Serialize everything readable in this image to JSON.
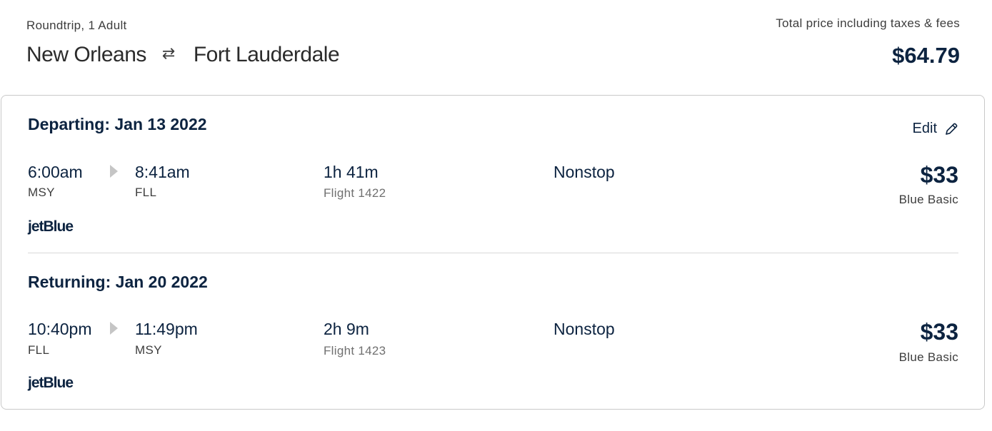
{
  "header": {
    "trip_type": "Roundtrip, 1 Adult",
    "origin": "New Orleans",
    "destination": "Fort Lauderdale",
    "total_label": "Total price including taxes & fees",
    "total_price": "$64.79"
  },
  "edit_label": "Edit",
  "departing": {
    "title": "Departing: Jan 13 2022",
    "depart_time": "6:00am",
    "depart_code": "MSY",
    "arrive_time": "8:41am",
    "arrive_code": "FLL",
    "duration": "1h 41m",
    "flight": "Flight 1422",
    "stops": "Nonstop",
    "price": "$33",
    "fare_class": "Blue Basic",
    "airline": "jetBlue"
  },
  "returning": {
    "title": "Returning: Jan 20 2022",
    "depart_time": "10:40pm",
    "depart_code": "FLL",
    "arrive_time": "11:49pm",
    "arrive_code": "MSY",
    "duration": "2h 9m",
    "flight": "Flight 1423",
    "stops": "Nonstop",
    "price": "$33",
    "fare_class": "Blue Basic",
    "airline": "jetBlue"
  },
  "colors": {
    "brand_navy": "#0c2340",
    "muted_text": "#707070",
    "border": "#c9c9c9"
  }
}
